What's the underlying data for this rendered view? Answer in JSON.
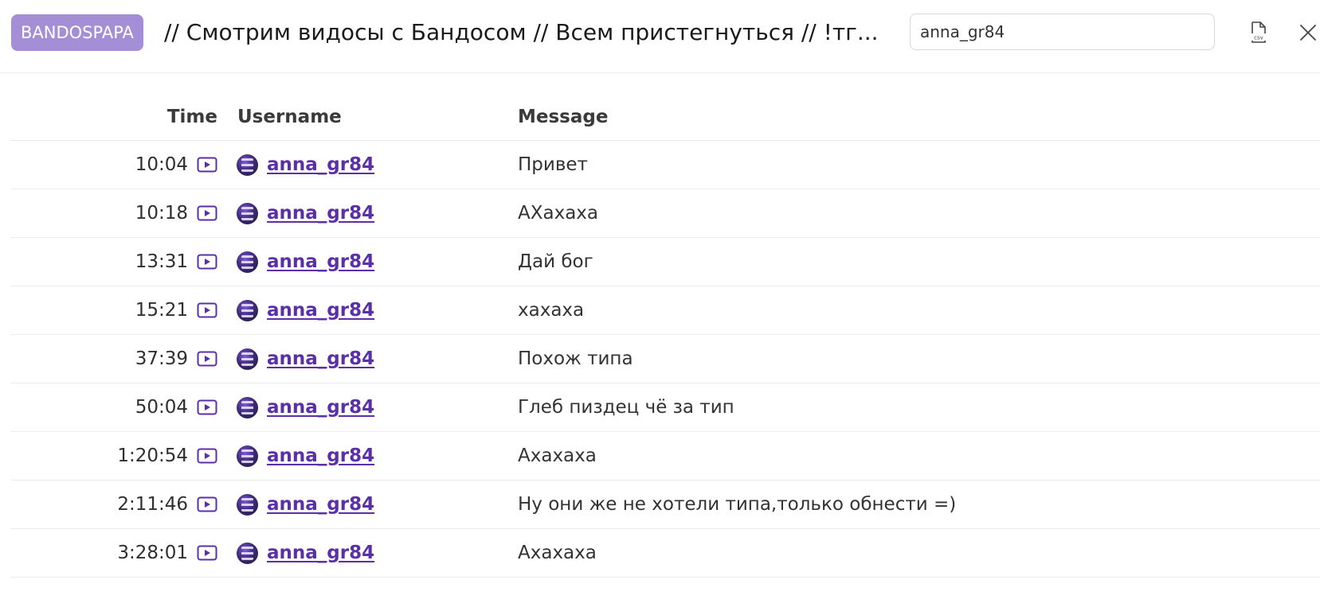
{
  "header": {
    "channel_badge": "BANDOSPAPA",
    "title": "// Смотрим видосы с Бандосом // Всем пристегнуться // !тг...",
    "search_value": "anna_gr84"
  },
  "table": {
    "columns": {
      "time": "Time",
      "username": "Username",
      "message": "Message"
    },
    "rows": [
      {
        "time": "10:04",
        "username": "anna_gr84",
        "message": "Привет"
      },
      {
        "time": "10:18",
        "username": "anna_gr84",
        "message": "АХахаха"
      },
      {
        "time": "13:31",
        "username": "anna_gr84",
        "message": "Дай бог"
      },
      {
        "time": "15:21",
        "username": "anna_gr84",
        "message": "хахаха"
      },
      {
        "time": "37:39",
        "username": "anna_gr84",
        "message": "Похож типа"
      },
      {
        "time": "50:04",
        "username": "anna_gr84",
        "message": "Глеб пиздец чё за тип"
      },
      {
        "time": "1:20:54",
        "username": "anna_gr84",
        "message": "Ахахаха"
      },
      {
        "time": "2:11:46",
        "username": "anna_gr84",
        "message": "Ну они же не хотели типа,только обнести =)"
      },
      {
        "time": "3:28:01",
        "username": "anna_gr84",
        "message": "Ахахаха"
      }
    ]
  },
  "icons": {
    "csv_export": "csv-file-icon",
    "close": "close-icon",
    "play": "play-icon",
    "avatar": "user-avatar"
  },
  "colors": {
    "badge_bg": "#a48fd6",
    "username": "#5a2fa8",
    "play_icon": "#5a2fa8"
  }
}
